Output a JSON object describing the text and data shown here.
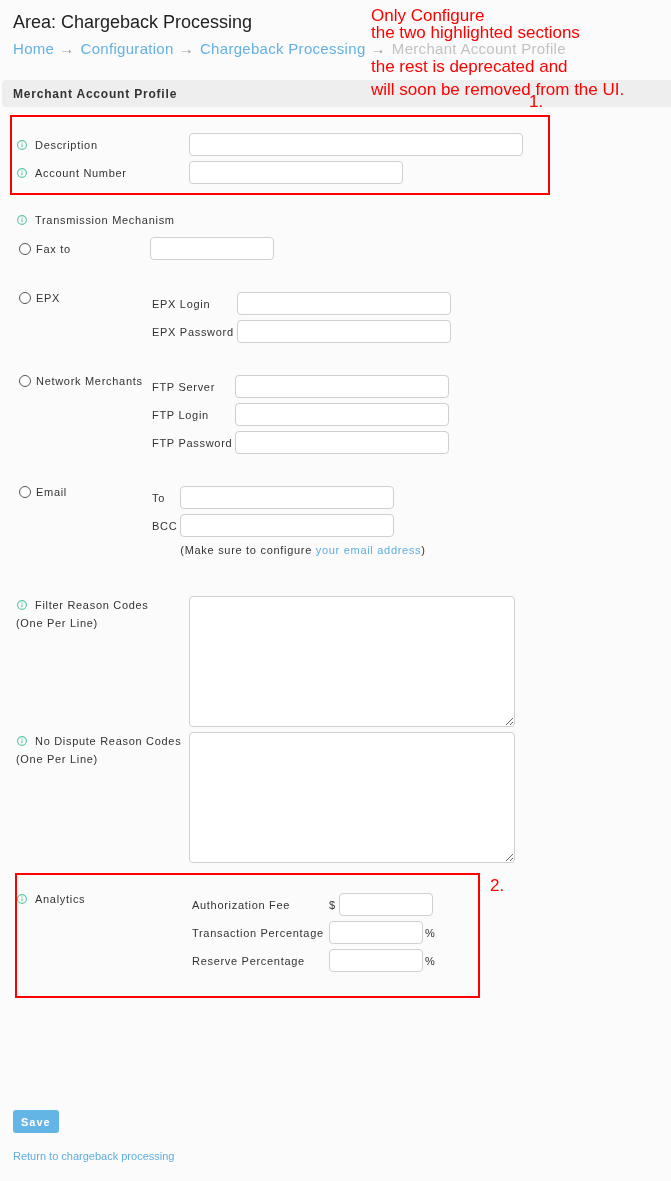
{
  "header": {
    "title": "Area: Chargeback Processing",
    "breadcrumb": [
      {
        "label": "Home",
        "current": false,
        "arrow": "→"
      },
      {
        "label": "Configuration",
        "current": false,
        "arrow": "→"
      },
      {
        "label": "Chargeback Processing",
        "current": false,
        "arrow": "→"
      },
      {
        "label": "Merchant Account Profile",
        "current": true
      }
    ]
  },
  "annotation": {
    "lines": [
      "Only Configure",
      "the two highlighted sections",
      "the rest is deprecated and",
      "will soon be removed from the UI."
    ]
  },
  "panel": {
    "title": "Merchant Account Profile"
  },
  "sections": [
    {
      "kind": "fields",
      "highlighted": true,
      "marker": "1.",
      "fields": [
        {
          "label": "Description",
          "info": true
        },
        {
          "label": "Account Number",
          "info": true
        }
      ]
    },
    {
      "kind": "transmission",
      "highlighted": false,
      "label": "Transmission Mechanism",
      "info": true,
      "options": [
        {
          "kind": "inline",
          "label": "Fax to",
          "selected": false
        },
        {
          "kind": "group",
          "label": "EPX",
          "selected": false,
          "fields": [
            {
              "label": "EPX Login"
            },
            {
              "label": "EPX Password"
            }
          ]
        },
        {
          "kind": "group",
          "label": "Network Merchants",
          "selected": false,
          "fields": [
            {
              "label": "FTP Server"
            },
            {
              "label": "FTP Login"
            },
            {
              "label": "FTP Password"
            }
          ]
        },
        {
          "kind": "group",
          "label": "Email",
          "selected": false,
          "fields": [
            {
              "label": "To"
            },
            {
              "label": "BCC"
            }
          ],
          "note": {
            "before": "(Make sure to configure ",
            "link": "your email address",
            "after": ")"
          }
        }
      ]
    },
    {
      "kind": "textarea",
      "highlighted": false,
      "label": "Filter Reason Codes",
      "hint": "(One Per Line)",
      "info": true
    },
    {
      "kind": "textarea",
      "highlighted": false,
      "label": "No Dispute Reason Codes",
      "hint": "(One Per Line)",
      "info": true
    },
    {
      "kind": "analytics",
      "highlighted": true,
      "marker": "2.",
      "label": "Analytics",
      "info": true,
      "fields": [
        {
          "label": "Authorization Fee",
          "prefix": "$"
        },
        {
          "label": "Transaction Percentage",
          "suffix": "%"
        },
        {
          "label": "Reserve Percentage",
          "suffix": "%"
        }
      ]
    }
  ],
  "actions": {
    "save": "Save",
    "back_link": "Return to chargeback processing"
  }
}
